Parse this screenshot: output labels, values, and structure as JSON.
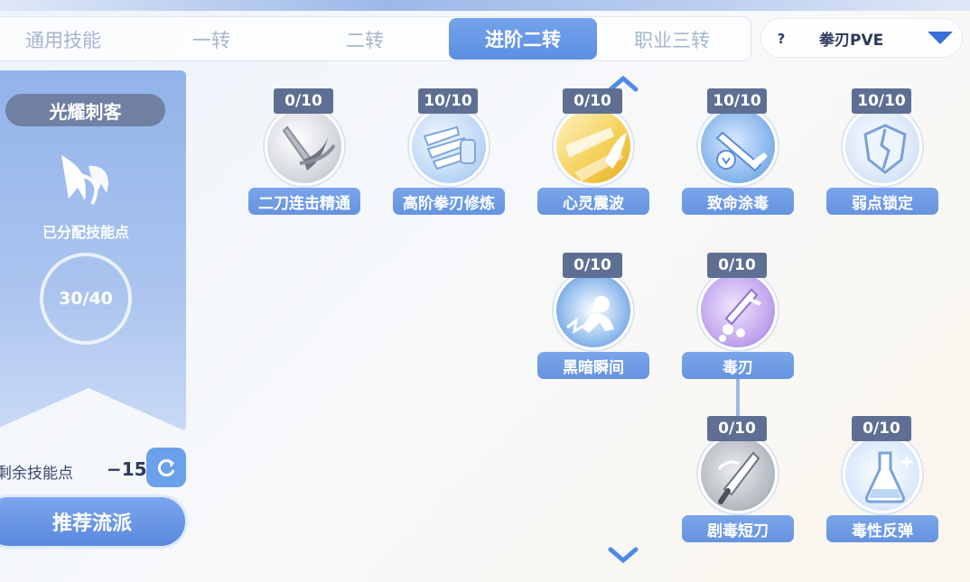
{
  "tabs": [
    {
      "label": "通用技能",
      "active": false
    },
    {
      "label": "一转",
      "active": false
    },
    {
      "label": "二转",
      "active": false
    },
    {
      "label": "进阶二转",
      "active": true
    },
    {
      "label": "职业三转",
      "active": false
    }
  ],
  "build_selector": {
    "help": "?",
    "label": "拳刃PVE"
  },
  "left_panel": {
    "class_name": "光耀刺客",
    "assigned_label": "已分配技能点",
    "assigned_points": "30/40",
    "remaining_label": "剩余技能点",
    "remaining_value": "−15",
    "recommend_label": "推荐流派"
  },
  "skills": [
    {
      "name": "二刀连击精通",
      "level": "0/10",
      "icon": "crossed-blades-icon"
    },
    {
      "name": "高阶拳刃修炼",
      "level": "10/10",
      "icon": "claw-blades-icon"
    },
    {
      "name": "心灵震波",
      "level": "0/10",
      "icon": "psychic-wave-icon"
    },
    {
      "name": "致命涂毒",
      "level": "10/10",
      "icon": "poisoned-sword-icon"
    },
    {
      "name": "弱点锁定",
      "level": "10/10",
      "icon": "broken-shield-icon"
    },
    {
      "name": "黑暗瞬间",
      "level": "0/10",
      "icon": "dark-dash-icon"
    },
    {
      "name": "毒刃",
      "level": "0/10",
      "icon": "poison-blade-icon"
    },
    {
      "name": "剧毒短刀",
      "level": "0/10",
      "icon": "venom-dagger-icon"
    },
    {
      "name": "毒性反弹",
      "level": "0/10",
      "icon": "poison-flask-icon"
    }
  ],
  "colors": {
    "accent": "#5c8fe2",
    "badge": "#5e6f93",
    "text_dark": "#2c3a5a"
  }
}
